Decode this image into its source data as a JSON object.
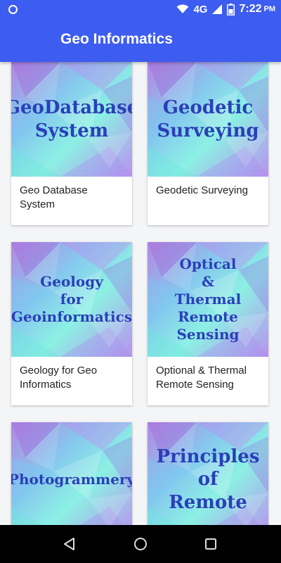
{
  "status_bar": {
    "network": "4G",
    "time": "7:22",
    "ampm": "PM",
    "icons": [
      "notification-dot-icon",
      "wifi-icon",
      "signal-icon",
      "battery-icon"
    ]
  },
  "app_bar": {
    "title": "Geo Informatics"
  },
  "colors": {
    "primary": "#3d5cf0",
    "cover_text": "#2b3fb8"
  },
  "cards": [
    {
      "cover_lines": [
        "GeoDatabase",
        "System"
      ],
      "caption": "Geo Database System"
    },
    {
      "cover_lines": [
        "Geodetic",
        "Surveying"
      ],
      "caption": "Geodetic Surveying"
    },
    {
      "cover_lines": [
        "Geology",
        "for",
        "Geoinformatics"
      ],
      "caption": "Geology for Geo Informatics"
    },
    {
      "cover_lines": [
        "Optical",
        "&",
        "Thermal",
        "Remote Sensing"
      ],
      "caption": "Optional & Thermal Remote Sensing"
    },
    {
      "cover_lines": [
        "Photogrammery"
      ],
      "caption": ""
    },
    {
      "cover_lines": [
        "Principles",
        "of",
        "Remote"
      ],
      "caption": ""
    }
  ],
  "nav_bar": {
    "icons": [
      "back-triangle-icon",
      "home-circle-icon",
      "recents-square-icon"
    ]
  }
}
